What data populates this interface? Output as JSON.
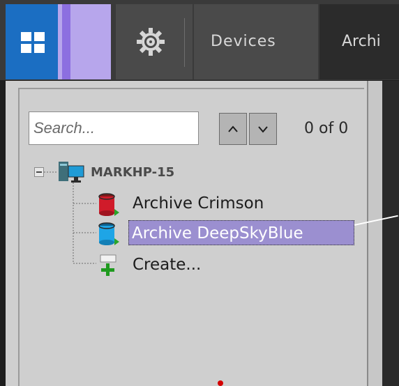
{
  "toolbar": {
    "devices_label": "Devices",
    "archive_label": "Archi"
  },
  "search": {
    "placeholder": "Search...",
    "count": "0 of 0"
  },
  "tree": {
    "host": "MARKHP-15",
    "items": [
      {
        "label": "Archive Crimson",
        "color": "#d01b2a"
      },
      {
        "label": "Archive DeepSkyBlue",
        "color": "#1ea5e6",
        "selected": true
      },
      {
        "label": "Create..."
      }
    ]
  },
  "colors": {
    "accent_blue": "#1b6ec2",
    "accent_purple": "#b7a6ec",
    "selection": "#9b8fd0"
  }
}
